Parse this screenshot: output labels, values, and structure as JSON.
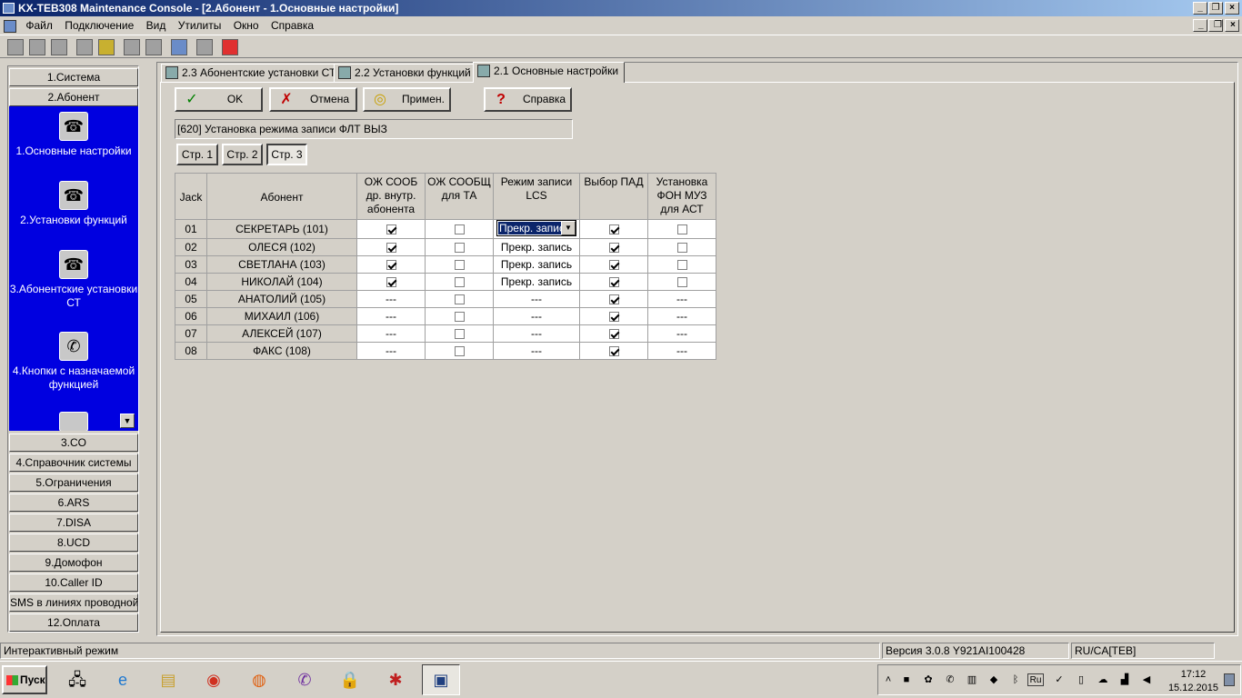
{
  "window": {
    "title": "KX-TEB308 Maintenance Console - [2.Абонент - 1.Основные настройки]"
  },
  "menu": {
    "items": [
      "Файл",
      "Подключение",
      "Вид",
      "Утилиты",
      "Окно",
      "Справка"
    ]
  },
  "sidebar": {
    "categories_top": [
      "1.Система",
      "2.Абонент"
    ],
    "sub_items": [
      "1.Основные настройки",
      "2.Установки функций",
      "3.Абонентские установки СТ",
      "4.Кнопки с назначаемой функцией"
    ],
    "categories_bottom": [
      "3.CO",
      "4.Справочник системы",
      "5.Ограничения",
      "6.ARS",
      "7.DISA",
      "8.UCD",
      "9.Домофон",
      "10.Caller ID",
      "SMS в линиях проводной связи",
      "12.Оплата"
    ]
  },
  "tabs": [
    "2.3 Абонентские установки СТ",
    "2.2 Установки функций",
    "2.1 Основные настройки"
  ],
  "buttons": {
    "ok": "OK",
    "cancel": "Отмена",
    "apply": "Примен.",
    "help": "Справка"
  },
  "section_title": "[620] Установка режима записи ФЛТ ВЫЗ",
  "pages": [
    "Стр. 1",
    "Стр. 2",
    "Стр. 3"
  ],
  "table": {
    "headers": [
      "Jack",
      "Абонент",
      "ОЖ СООБ др. внутр. абонента",
      "ОЖ СООБЩ для ТА",
      "Режим записи LCS",
      "Выбор ПАД",
      "Установка ФОН МУЗ для АСТ"
    ],
    "rows": [
      {
        "jack": "01",
        "name": "СЕКРЕТАРЬ (101)",
        "c1": true,
        "c2": false,
        "lcs": "Прекр. запись",
        "pad": true,
        "fon": false
      },
      {
        "jack": "02",
        "name": "ОЛЕСЯ (102)",
        "c1": true,
        "c2": false,
        "lcs": "Прекр. запись",
        "pad": true,
        "fon": false
      },
      {
        "jack": "03",
        "name": "СВЕТЛАНА (103)",
        "c1": true,
        "c2": false,
        "lcs": "Прекр. запись",
        "pad": true,
        "fon": false
      },
      {
        "jack": "04",
        "name": "НИКОЛАЙ (104)",
        "c1": true,
        "c2": false,
        "lcs": "Прекр. запись",
        "pad": true,
        "fon": false
      },
      {
        "jack": "05",
        "name": "АНАТОЛИЙ (105)",
        "c1": "---",
        "c2": false,
        "lcs": "---",
        "pad": true,
        "fon": "---"
      },
      {
        "jack": "06",
        "name": "МИХАИЛ (106)",
        "c1": "---",
        "c2": false,
        "lcs": "---",
        "pad": true,
        "fon": "---"
      },
      {
        "jack": "07",
        "name": "АЛЕКСЕЙ (107)",
        "c1": "---",
        "c2": false,
        "lcs": "---",
        "pad": true,
        "fon": "---"
      },
      {
        "jack": "08",
        "name": "ФАКС (108)",
        "c1": "---",
        "c2": false,
        "lcs": "---",
        "pad": true,
        "fon": "---"
      }
    ]
  },
  "status": {
    "mode": "Интерактивный режим",
    "version": "Версия 3.0.8 Y921AI100428",
    "region": "RU/CA[TEB]"
  },
  "taskbar": {
    "start": "Пуск",
    "time": "17:12",
    "date": "15.12.2015",
    "lang": "Ru"
  }
}
